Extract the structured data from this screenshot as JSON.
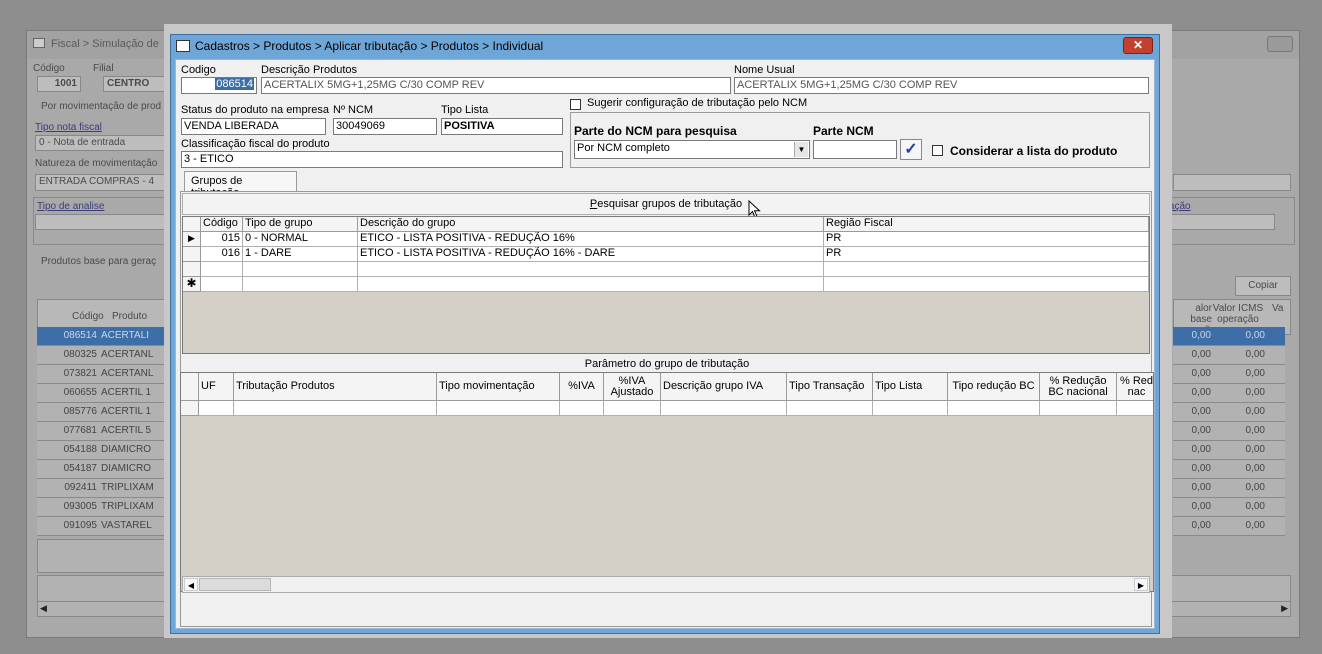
{
  "background_window": {
    "title": "Fiscal > Simulação de",
    "codigo_label": "Código",
    "codigo_value": "1001",
    "filial_label": "Filial",
    "filial_value": "CENTRO",
    "movimentacao_text": "Por movimentação de prod",
    "tipo_nota_label": "Tipo nota fiscal",
    "tipo_nota_value": "0 - Nota de entrada",
    "natureza_label": "Natureza de movimentação",
    "natureza_value": "ENTRADA COMPRAS - 4",
    "tipo_analise_label": "Tipo de analise",
    "tributacao_link": "butação",
    "produtos_base_label": "Produtos base para geraç",
    "copiar_button": "Copiar",
    "col_codigo": "Código",
    "col_produto": "Produto",
    "col_valor_base": "alor base operação",
    "col_valor_icms": "Valor ICMS operação",
    "col_va": "Va",
    "rows": [
      {
        "codigo": "086514",
        "produto": "ACERTALI",
        "base": "0,00",
        "icms": "0,00"
      },
      {
        "codigo": "080325",
        "produto": "ACERTANL",
        "base": "0,00",
        "icms": "0,00"
      },
      {
        "codigo": "073821",
        "produto": "ACERTANL",
        "base": "0,00",
        "icms": "0,00"
      },
      {
        "codigo": "060655",
        "produto": "ACERTIL 1",
        "base": "0,00",
        "icms": "0,00"
      },
      {
        "codigo": "085776",
        "produto": "ACERTIL 1",
        "base": "0,00",
        "icms": "0,00"
      },
      {
        "codigo": "077681",
        "produto": "ACERTIL 5",
        "base": "0,00",
        "icms": "0,00"
      },
      {
        "codigo": "054188",
        "produto": "DIAMICRO",
        "base": "0,00",
        "icms": "0,00"
      },
      {
        "codigo": "054187",
        "produto": "DIAMICRO",
        "base": "0,00",
        "icms": "0,00"
      },
      {
        "codigo": "092411",
        "produto": "TRIPLIXAM",
        "base": "0,00",
        "icms": "0,00"
      },
      {
        "codigo": "093005",
        "produto": "TRIPLIXAM",
        "base": "0,00",
        "icms": "0,00"
      },
      {
        "codigo": "091095",
        "produto": "VASTAREL",
        "base": "0,00",
        "icms": "0,00"
      }
    ]
  },
  "dialog": {
    "title": "Cadastros > Produtos > Aplicar tributação > Produtos > Individual",
    "close_label": "✕",
    "codigo_label": "Codigo",
    "codigo_value": "086514",
    "descricao_label": "Descrição  Produtos",
    "descricao_value": "ACERTALIX 5MG+1,25MG C/30 COMP REV",
    "nome_usual_label": "Nome Usual",
    "nome_usual_value": "ACERTALIX 5MG+1,25MG C/30 COMP REV",
    "status_label": "Status do produto na empresa",
    "status_value": "VENDA LIBERADA",
    "ncm_label": "Nº NCM",
    "ncm_value": "30049069",
    "tipo_lista_label": "Tipo Lista",
    "tipo_lista_value": "POSITIVA",
    "classificacao_label": "Classificação fiscal do produto",
    "classificacao_value": "3 - ETICO",
    "sugerir_label": "Sugerir configuração de tributação pelo NCM",
    "parte_ncm_pesquisa_label": "Parte do NCM para pesquisa",
    "parte_ncm_pesquisa_value": "Por NCM completo",
    "parte_ncm_label": "Parte NCM",
    "parte_ncm_value": "",
    "considerar_label": "Considerar a lista do produto",
    "tab_label": "Grupos de tributação",
    "pesquisar_button": "Pesquisar grupos de tributação",
    "grupos_grid": {
      "columns": [
        "Código",
        "Tipo de grupo",
        "Descrição do grupo",
        "Região Fiscal"
      ],
      "rows": [
        {
          "codigo": "015",
          "tipo": "0 - NORMAL",
          "descricao": "ETICO - LISTA POSITIVA - REDUÇÃO 16%",
          "regiao": "PR"
        },
        {
          "codigo": "016",
          "tipo": "1 - DARE",
          "descricao": "ETICO - LISTA POSITIVA - REDUÇÃO 16% - DARE",
          "regiao": "PR"
        }
      ],
      "current_marker": "▶",
      "new_marker": "✱"
    },
    "parametro_title": "Parâmetro do grupo de tributação",
    "parametro_grid": {
      "columns": [
        "UF",
        "Tributação Produtos",
        "Tipo movimentação",
        "%IVA",
        "%IVA Ajustado",
        "Descrição grupo IVA",
        "Tipo Transação",
        "Tipo Lista",
        "Tipo redução BC",
        "% Redução BC nacional",
        "% Red nac"
      ]
    },
    "scroll_left": "◀",
    "scroll_right": "▶"
  }
}
